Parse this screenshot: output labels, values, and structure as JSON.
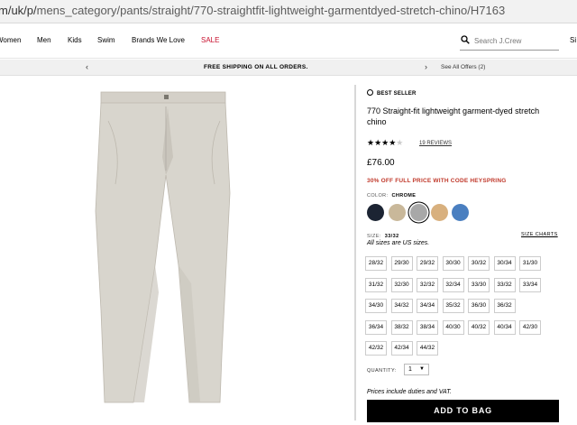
{
  "browser": {
    "url_prefix": "m/uk/p/",
    "url_path": "mens_category/pants/straight/770-straightfit-lightweight-garmentdyed-stretch-chino/H7163"
  },
  "nav": {
    "items": [
      "Women",
      "Men",
      "Kids",
      "Swim",
      "Brands We Love",
      "SALE"
    ],
    "search_placeholder": "Search J.Crew",
    "signin_partial": "Si"
  },
  "promo": {
    "left_arrow": "‹",
    "message": "FREE SHIPPING ON ALL ORDERS.",
    "right_arrow": "›",
    "offers": "See All Offers (2)"
  },
  "product": {
    "badge": "BEST SELLER",
    "title": "770 Straight-fit lightweight garment-dyed stretch chino",
    "rating": 3.5,
    "stars_on": "★★★★",
    "stars_off": "★",
    "reviews": "19 REVIEWS",
    "price": "£76.00",
    "promo_code": "30% OFF FULL PRICE WITH CODE HEYSPRING",
    "color_label": "COLOR:",
    "color_value": "CHROME",
    "swatches": [
      {
        "name": "navy",
        "color": "#1c2433"
      },
      {
        "name": "khaki",
        "color": "#c9b89a"
      },
      {
        "name": "chrome",
        "color": "#a8a8a8",
        "selected": true
      },
      {
        "name": "tan",
        "color": "#d8b07e"
      },
      {
        "name": "blue",
        "color": "#4a7fc0"
      }
    ],
    "size_label": "SIZE:",
    "size_value": "33/32",
    "size_charts": "SIZE CHARTS",
    "size_note": "All sizes are US sizes.",
    "sizes": [
      "28/32",
      "29/30",
      "29/32",
      "30/30",
      "30/32",
      "30/34",
      "31/30",
      "31/32",
      "32/30",
      "32/32",
      "32/34",
      "33/30",
      "33/32",
      "33/34",
      "34/30",
      "34/32",
      "34/34",
      "35/32",
      "36/30",
      "36/32",
      "36/34",
      "38/32",
      "38/34",
      "40/30",
      "40/32",
      "40/34",
      "42/30",
      "42/32",
      "42/34",
      "44/32"
    ],
    "quantity_label": "QUANTITY:",
    "quantity_value": "1",
    "duties_note": "Prices include duties and VAT.",
    "add_to_bag": "ADD TO BAG"
  }
}
